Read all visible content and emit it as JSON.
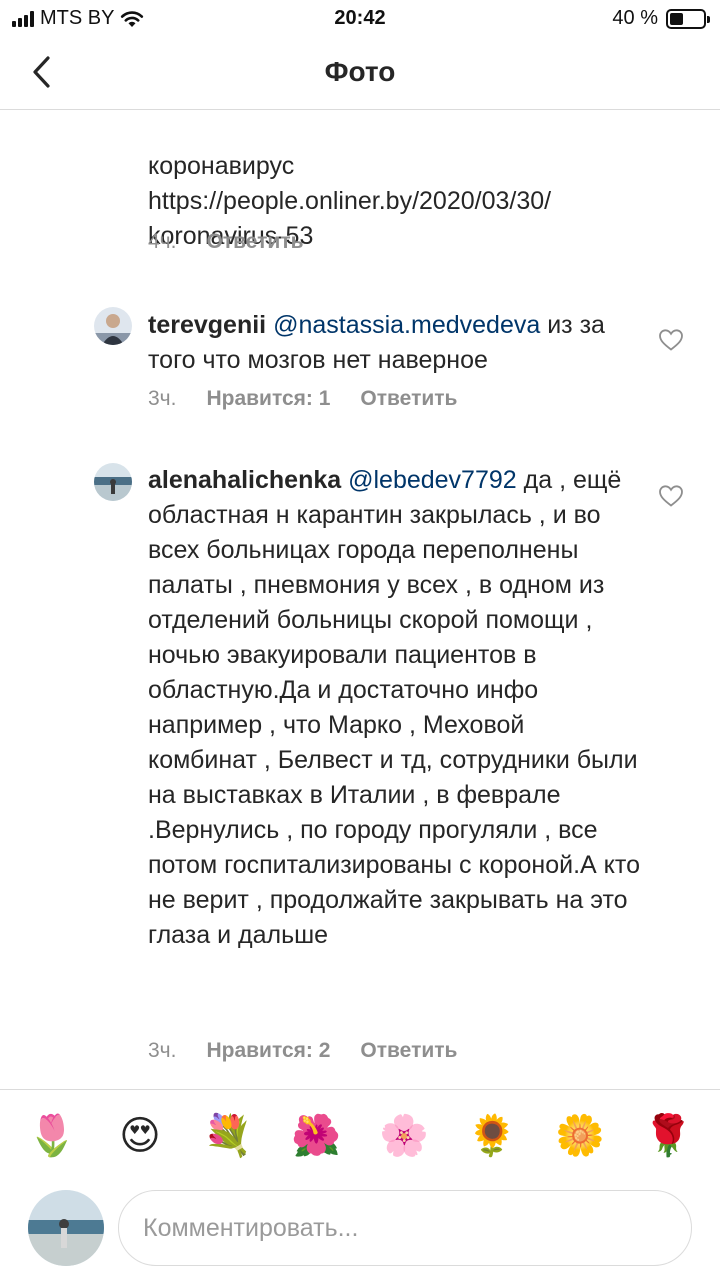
{
  "status_bar": {
    "carrier": "MTS BY",
    "time": "20:42",
    "battery_text": "40 %",
    "battery_level": 0.4
  },
  "header": {
    "title": "Фото",
    "back_icon": "chevron-left-icon"
  },
  "comments": [
    {
      "text": "коронавирус\nhttps://people.onliner.by/2020/03/30/\nkoronavirus-53",
      "time": "4ч.",
      "reply_label": "Ответить"
    },
    {
      "username": "terevgenii",
      "mention": "@nastassia.medvedeva",
      "text": " из за того что мозгов нет наверное",
      "time": "3ч.",
      "likes_label": "Нравится: 1",
      "reply_label": "Ответить"
    },
    {
      "username": "alenahalichenka",
      "mention": "@lebedev7792",
      "text": " да , ещё областная н карантин закрылась , и во всех больницах города переполнены палаты , пневмония у всех , в одном из отделений больницы скорой помощи , ночью эвакуировали пациентов в областную.Да и достаточно инфо например , что Марко , Меховой комбинат , Белвест и тд, сотрудники были на выставках в Италии , в феврале .Вернулись , по городу прогуляли , все потом госпитализированы с короной.А кто не верит , продолжайте закрывать на это глаза и дальше",
      "time": "3ч.",
      "likes_label": "Нравится: 2",
      "reply_label": "Ответить"
    }
  ],
  "emoji_bar": [
    "🌷",
    "😍",
    "💐",
    "🌺",
    "🌸",
    "🌻",
    "🌼",
    "🌹"
  ],
  "composer": {
    "placeholder": "Комментировать..."
  }
}
